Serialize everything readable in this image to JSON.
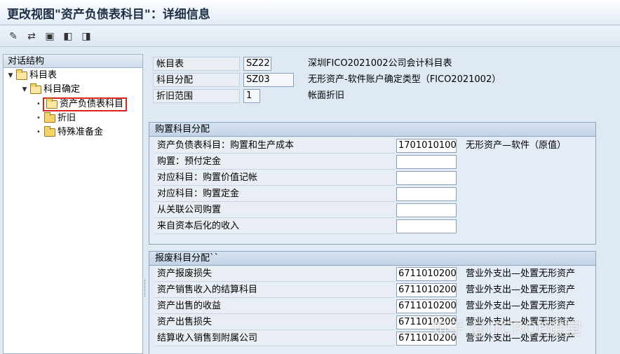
{
  "window": {
    "title": "更改视图\"资产负债表科目\"：详细信息"
  },
  "toolbar": {
    "buttons": [
      {
        "name": "edit-pencil-icon",
        "glyph": "✎"
      },
      {
        "name": "display-change-icon",
        "glyph": "⇄"
      },
      {
        "name": "save-icon",
        "glyph": "▣"
      },
      {
        "name": "previous-entry-icon",
        "glyph": "◧"
      },
      {
        "name": "next-entry-icon",
        "glyph": "◨"
      }
    ]
  },
  "tree": {
    "header": "对话结构",
    "nodes": {
      "chart_of_accounts": "科目表",
      "account_determination": "科目确定",
      "balance_sheet_accounts": "资产负债表科目",
      "depreciation": "折旧",
      "special_reserves": "特殊准备金"
    }
  },
  "header_fields": [
    {
      "label": "帐目表",
      "value": "SZ22",
      "desc": "深圳FICO2021002公司会计科目表"
    },
    {
      "label": "科目分配",
      "value": "SZ03",
      "desc": "无形资产-软件账户确定类型（FICO2021002）"
    },
    {
      "label": "折旧范围",
      "value": "1",
      "desc": "帐面折旧"
    }
  ],
  "purchase_group": {
    "title": "购置科目分配",
    "rows": [
      {
        "label": "资产负债表科目：购置和生产成本",
        "value": "1701010100",
        "desc": "无形资产—软件（原值）"
      },
      {
        "label": "购置：预付定金",
        "value": "",
        "desc": ""
      },
      {
        "label": "对应科目：购置价值记帐",
        "value": "",
        "desc": ""
      },
      {
        "label": "对应科目：购置定金",
        "value": "",
        "desc": ""
      },
      {
        "label": "从关联公司购置",
        "value": "",
        "desc": ""
      },
      {
        "label": "来自资本后化的收入",
        "value": "",
        "desc": ""
      }
    ]
  },
  "retirement_group": {
    "title": "报废科目分配``",
    "rows": [
      {
        "label": "资产报废损失",
        "value": "6711010200",
        "desc": "营业外支出—处置无形资产"
      },
      {
        "label": "资产销售收入的结算科目",
        "value": "6711010200",
        "desc": "营业外支出—处置无形资产"
      },
      {
        "label": "资产出售的收益",
        "value": "6711010200",
        "desc": "营业外支出—处置无形资产"
      },
      {
        "label": "资产出售损失",
        "value": "6711010200",
        "desc": "营业外支出—处置无形资产"
      },
      {
        "label": "结算收入销售到附属公司",
        "value": "6711010200",
        "desc": "营业外支出—处置无形资产"
      }
    ]
  },
  "watermark": "知乎 @ITCROP讲堂"
}
